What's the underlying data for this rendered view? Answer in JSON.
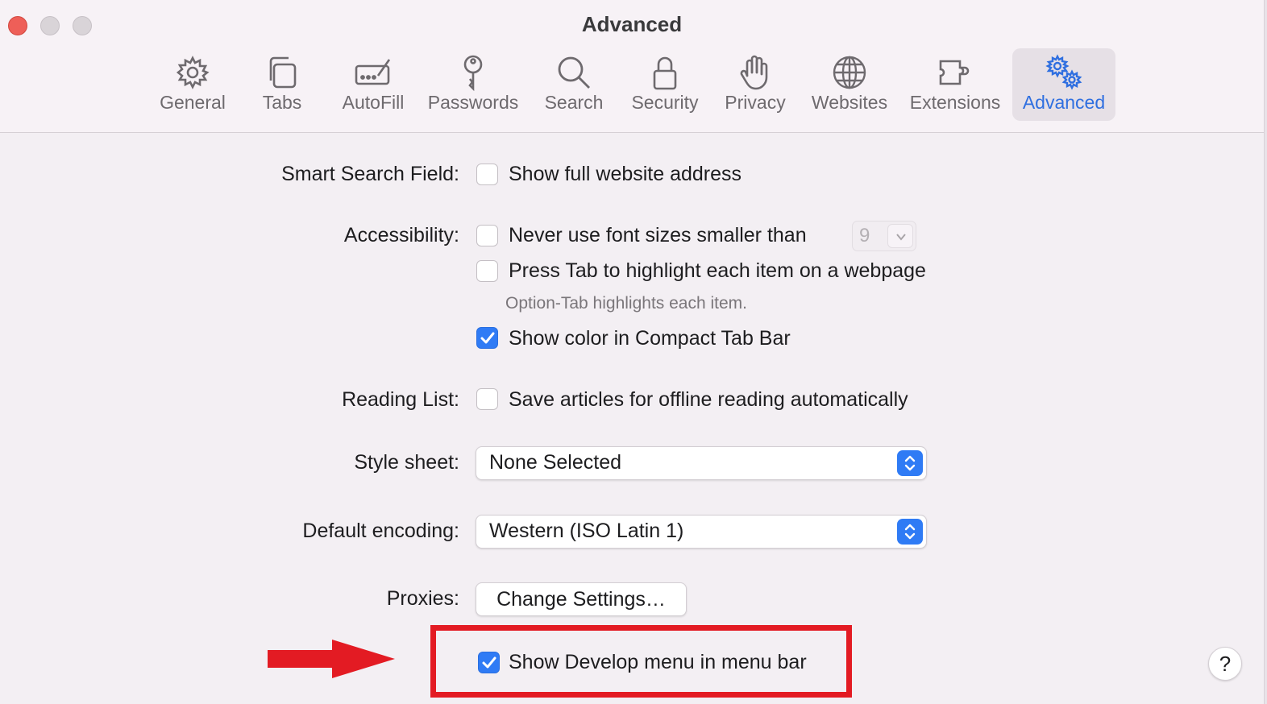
{
  "window": {
    "title": "Advanced"
  },
  "toolbar": {
    "tabs": [
      {
        "label": "General",
        "icon": "gear-icon"
      },
      {
        "label": "Tabs",
        "icon": "tabs-icon"
      },
      {
        "label": "AutoFill",
        "icon": "autofill-icon"
      },
      {
        "label": "Passwords",
        "icon": "key-icon"
      },
      {
        "label": "Search",
        "icon": "search-icon"
      },
      {
        "label": "Security",
        "icon": "lock-icon"
      },
      {
        "label": "Privacy",
        "icon": "hand-icon"
      },
      {
        "label": "Websites",
        "icon": "globe-icon"
      },
      {
        "label": "Extensions",
        "icon": "puzzle-icon"
      },
      {
        "label": "Advanced",
        "icon": "gears-icon"
      }
    ],
    "active_tab": "Advanced",
    "active_color": "#2f6fe0"
  },
  "settings": {
    "smart_search": {
      "label": "Smart Search Field:",
      "show_full_address": {
        "label": "Show full website address",
        "checked": false
      }
    },
    "accessibility": {
      "label": "Accessibility:",
      "min_font": {
        "label": "Never use font sizes smaller than",
        "checked": false,
        "value": "9"
      },
      "press_tab": {
        "label": "Press Tab to highlight each item on a webpage",
        "checked": false
      },
      "hint": "Option-Tab highlights each item.",
      "show_color": {
        "label": "Show color in Compact Tab Bar",
        "checked": true
      }
    },
    "reading_list": {
      "label": "Reading List:",
      "save_offline": {
        "label": "Save articles for offline reading automatically",
        "checked": false
      }
    },
    "style_sheet": {
      "label": "Style sheet:",
      "value": "None Selected"
    },
    "default_encoding": {
      "label": "Default encoding:",
      "value": "Western (ISO Latin 1)"
    },
    "proxies": {
      "label": "Proxies:",
      "button": "Change Settings…"
    },
    "develop_menu": {
      "label": "Show Develop menu in menu bar",
      "checked": true
    }
  },
  "annotation": {
    "highlight_color": "#e31b23"
  },
  "help": {
    "label": "?"
  },
  "colors": {
    "checkbox_checked": "#2f7bf5"
  }
}
